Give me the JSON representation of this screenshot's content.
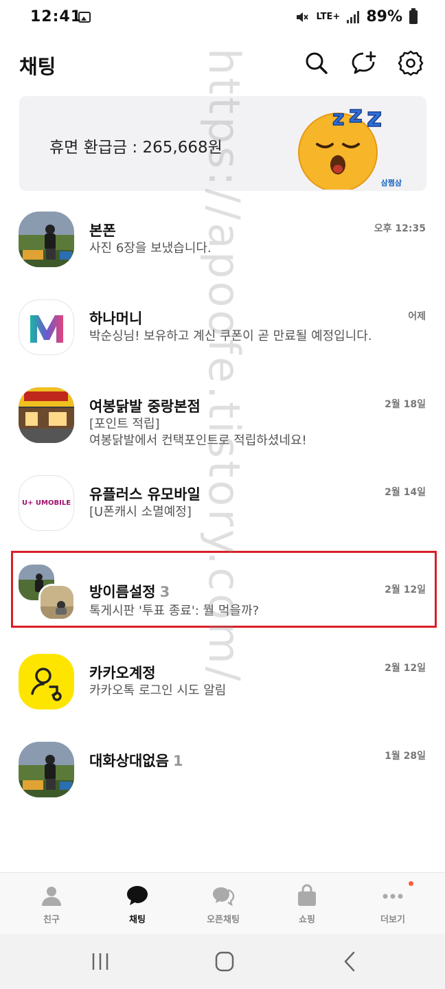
{
  "status_bar": {
    "time": "12:41",
    "network": "LTE+",
    "battery": "89%"
  },
  "header": {
    "title": "채팅"
  },
  "banner": {
    "text": "휴면 환급금 : 265,668원",
    "brand": "삼쩜삼"
  },
  "chats": [
    {
      "name": "본폰",
      "count": "",
      "message": "사진 6장을 보냈습니다.",
      "time": "오후 12:35"
    },
    {
      "name": "하나머니",
      "count": "",
      "message": "박순싱님! 보유하고 계신 쿠폰이 곧 만료될 예정입니다.",
      "time": "어제"
    },
    {
      "name": "여봉닭발 중랑본점",
      "count": "",
      "message": "[포인트 적립]\n여봉닭발에서 컨택포인트로 적립하셨네요!",
      "time": "2월 18일"
    },
    {
      "name": "유플러스 유모바일",
      "count": "",
      "message": "[U폰캐시 소멸예정]",
      "time": "2월 14일"
    },
    {
      "name": "방이름설정",
      "count": "3",
      "message": "톡게시판 '투표 종료': 뭘 먹을까?",
      "time": "2월 12일"
    },
    {
      "name": "카카오계정",
      "count": "",
      "message": "카카오톡 로그인 시도 알림",
      "time": "2월 12일"
    },
    {
      "name": "대화상대없음",
      "count": "1",
      "message": "",
      "time": "1월 28일"
    }
  ],
  "logos": {
    "umobile": "U+ UMOBILE",
    "hanamoney": "M"
  },
  "bottom_nav": {
    "items": [
      {
        "label": "친구"
      },
      {
        "label": "채팅"
      },
      {
        "label": "오픈채팅"
      },
      {
        "label": "쇼핑"
      },
      {
        "label": "더보기"
      }
    ]
  },
  "watermark": "https://apoofe.tistory.com/",
  "colors": {
    "highlight": "#d81f26",
    "kakao_yellow": "#fee500",
    "notification_dot": "#ff5a3c"
  }
}
